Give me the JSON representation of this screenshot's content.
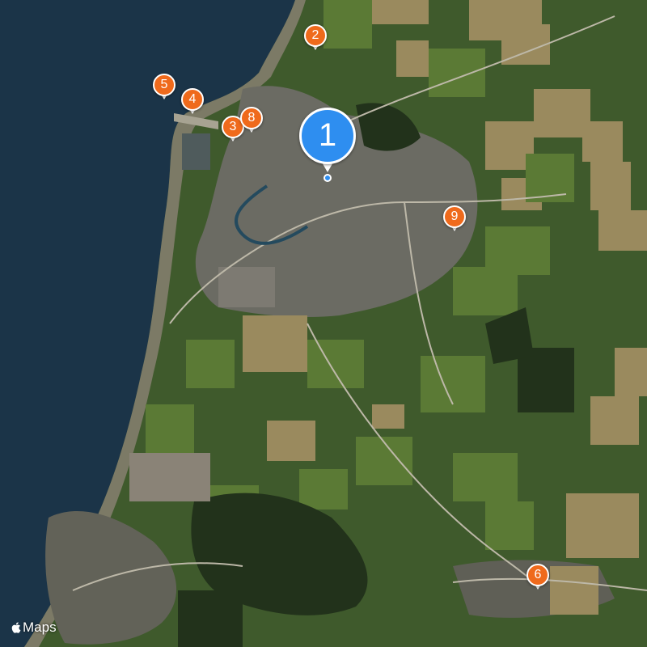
{
  "attribution": {
    "label": "Maps"
  },
  "colors": {
    "sea": "#1b3448",
    "land": "#3f5a2c",
    "field_light": "#9a8a5e",
    "pin_orange": "#ef6a1c",
    "pin_blue": "#2e8ef0"
  },
  "markers": [
    {
      "label": "1",
      "primary": true
    },
    {
      "label": "2"
    },
    {
      "label": "3"
    },
    {
      "label": "4"
    },
    {
      "label": "5"
    },
    {
      "label": "6"
    },
    {
      "label": "8"
    },
    {
      "label": "9"
    }
  ]
}
